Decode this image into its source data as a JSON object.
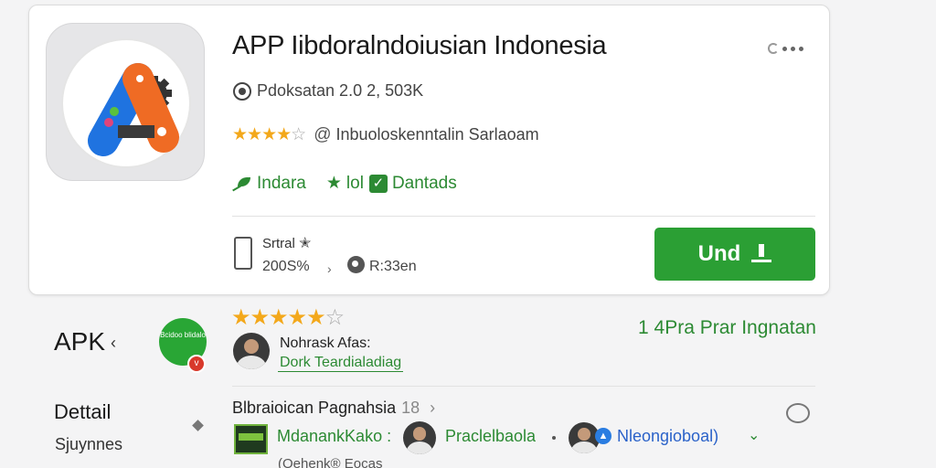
{
  "app": {
    "title": "APP Iibdoralndoiusian Indonesia",
    "meta": "Pdoksatan 2.0 2, 503K",
    "rating_stars": 4,
    "rating_text": "Inbuoloskenntalin Sarlaoam",
    "tags": [
      "Indara",
      "lol",
      "Dantads"
    ],
    "stat_label": "Srtral",
    "stat_value": "200S%",
    "stat_extra": "R:33en",
    "install_label": "Und"
  },
  "colors": {
    "accent_green": "#2b9f34",
    "star": "#f3a81b",
    "link_blue": "#2a62c9"
  },
  "left_panel": {
    "apk_label": "APK",
    "apk_arrow": "‹",
    "badge_text": "Bcidoo blidalo",
    "badge_count": "v",
    "detail_label": "Dettail",
    "detail_sub": "Sjuynnes"
  },
  "reviews": {
    "stars": 5,
    "rank_text": "1 4Pra Prar Ingnatan",
    "reviewer_name": "Nohrask Afas:",
    "reviewer_link": "Dork Teardialadiag"
  },
  "section2": {
    "title": "Blbraioican Pagnahsia",
    "count": "18",
    "chip1": "MdanankKako :",
    "chip2": "Praclelbaola",
    "chip3": "Nleongioboal)",
    "caption": "(Oehenk® Eocas"
  }
}
